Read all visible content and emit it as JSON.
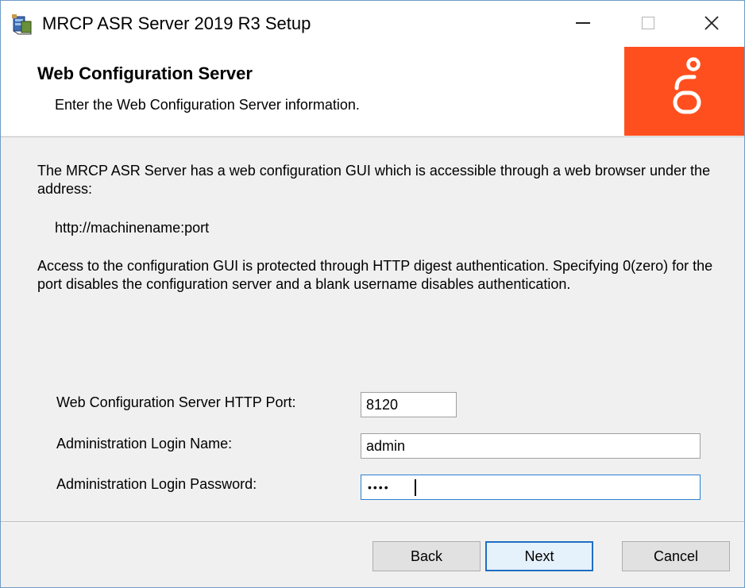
{
  "window": {
    "title": "MRCP ASR Server 2019 R3 Setup",
    "icon": "installer-icon",
    "controls": [
      "minimize",
      "maximize",
      "close"
    ]
  },
  "banner": {
    "title": "Web Configuration Server",
    "subtitle": "Enter the Web Configuration Server information.",
    "logo": "genesys-logo",
    "logo_color": "#ff4f1f"
  },
  "body": {
    "paragraph1": "The MRCP ASR Server has a web configuration GUI which is accessible through a web browser under the address:",
    "url": "http://machinename:port",
    "paragraph2": "Access to the configuration GUI is protected through HTTP digest authentication.  Specifying 0(zero) for the port disables the configuration server and a blank username disables authentication."
  },
  "form": {
    "port_label": "Web Configuration Server HTTP Port:",
    "port_value": "8120",
    "login_label": "Administration Login Name:",
    "login_value": "admin",
    "password_label": "Administration Login Password:",
    "password_value": "••••"
  },
  "buttons": {
    "back": "Back",
    "next": "Next",
    "cancel": "Cancel"
  },
  "colors": {
    "accent": "#ff4f1f",
    "focus": "#1f6fc2"
  }
}
